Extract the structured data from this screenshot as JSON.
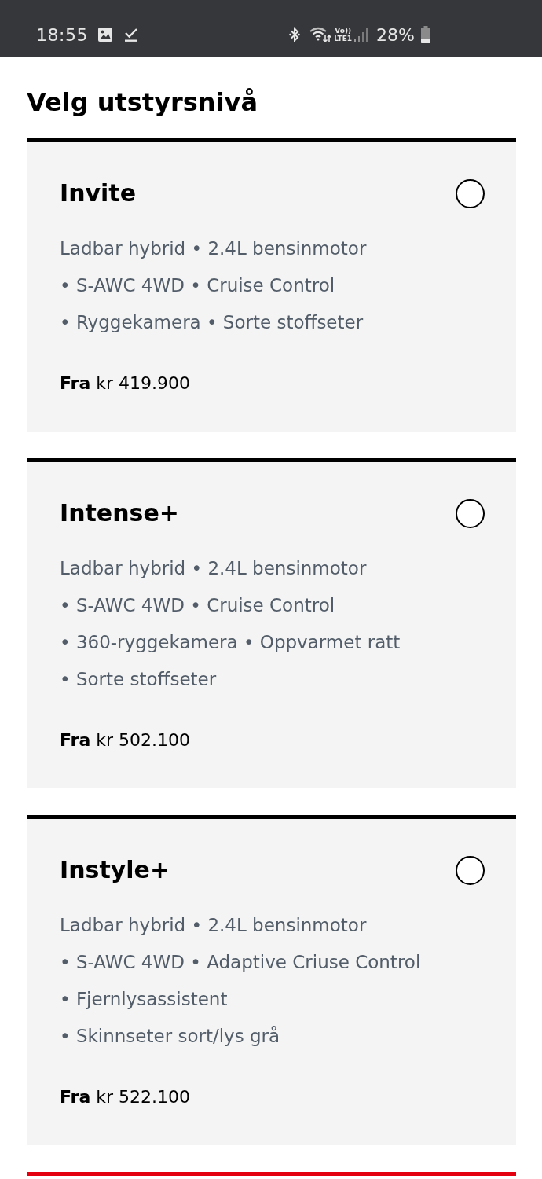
{
  "status_bar": {
    "time": "18:55",
    "volte": [
      "Vo))",
      "LTE1"
    ],
    "battery": "28%"
  },
  "heading": "Velg utstyrsnivå",
  "cards": [
    {
      "color": "#000000",
      "name": "Invite",
      "selected": false,
      "features": [
        "Ladbar hybrid • 2.4L bensinmotor",
        "• S-AWC 4WD • Cruise Control",
        "• Ryggekamera • Sorte stoffseter"
      ],
      "price": "**Fra** kr 419.900"
    },
    {
      "color": "#000000",
      "name": "Intense+",
      "selected": false,
      "features": [
        "Ladbar hybrid • 2.4L bensinmotor",
        "• S-AWC 4WD • Cruise Control",
        "• 360-ryggekamera • Oppvarmet ratt",
        "• Sorte stoffseter"
      ],
      "price": "**Fra** kr 502.100"
    },
    {
      "color": "#000000",
      "name": "Instyle+",
      "selected": false,
      "features": [
        "Ladbar hybrid • 2.4L bensinmotor",
        "• S-AWC 4WD • Adaptive Criuse Control",
        "• Fjernlysassistent",
        "• Skinnseter sort/lys grå"
      ],
      "price": "**Fra** kr 522.100"
    },
    {
      "color": "#e4000f"
    }
  ]
}
